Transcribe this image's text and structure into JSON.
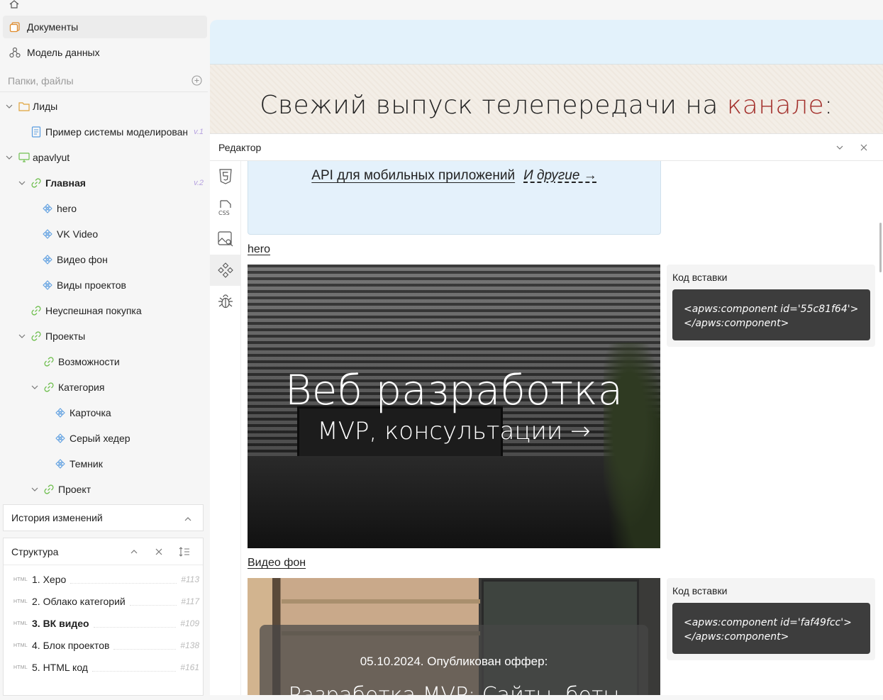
{
  "sidebar": {
    "nav": [
      {
        "label": "Документы",
        "icon": "documents-icon"
      },
      {
        "label": "Модель данных",
        "icon": "data-model-icon"
      }
    ],
    "search_placeholder": "Папки, файлы",
    "tree": [
      {
        "label": "Лиды"
      },
      {
        "label": "Пример системы моделирования",
        "version": "v.1"
      },
      {
        "label": "apavlyut"
      },
      {
        "label": "Главная",
        "version": "v.2"
      },
      {
        "label": "hero"
      },
      {
        "label": "VK Video"
      },
      {
        "label": "Видео фон"
      },
      {
        "label": "Виды проектов"
      },
      {
        "label": "Неуспешная покупка"
      },
      {
        "label": "Проекты"
      },
      {
        "label": "Возможности"
      },
      {
        "label": "Категория"
      },
      {
        "label": "Карточка"
      },
      {
        "label": "Серый хедер"
      },
      {
        "label": "Темник"
      },
      {
        "label": "Проект"
      }
    ],
    "history_title": "История изменений",
    "structure": {
      "title": "Структура",
      "rows": [
        {
          "tag": "HTML",
          "label": "1. Херо",
          "id": "#113"
        },
        {
          "tag": "HTML",
          "label": "2. Облако категорий",
          "id": "#117"
        },
        {
          "tag": "HTML",
          "label": "3. ВК видео",
          "id": "#109"
        },
        {
          "tag": "HTML",
          "label": "4. Блок проектов",
          "id": "#138"
        },
        {
          "tag": "HTML",
          "label": "5. HTML код",
          "id": "#161"
        }
      ]
    }
  },
  "preview": {
    "headline_main": "Свежий выпуск телепередачи на ",
    "headline_accent": "канале",
    "headline_end": ":"
  },
  "editor": {
    "title": "Редактор",
    "prev_links": {
      "first": "API для мобильных приложений",
      "second": "И другие →"
    },
    "components": [
      {
        "title": "hero",
        "heading": "Веб разработка",
        "subheading": "MVP, консультации →",
        "code_label": "Код вставки",
        "code": "<apws:component id='55c81f64'></apws:component>"
      },
      {
        "title": "Видео фон",
        "date_line": "05.10.2024. Опубликован оффер:",
        "big_line": "Разработка MVP: Сайты, боты",
        "code_label": "Код вставки",
        "code": "<apws:component id='faf49fcc'></apws:component>"
      }
    ]
  },
  "colors": {
    "accent": "#a3302c",
    "version": "#b7a3e0",
    "tree_icon": "#5a9de0",
    "link_icon": "#6fbf4f"
  }
}
